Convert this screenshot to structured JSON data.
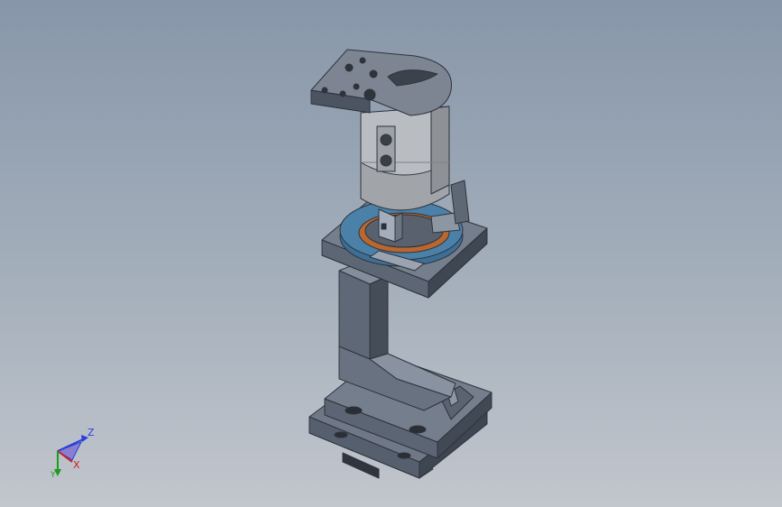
{
  "viewport": {
    "background_top": "#8796a9",
    "background_bottom": "#c2c6cd"
  },
  "model": {
    "part_color": "#66707f",
    "cylinder_color": "#b9bcc0",
    "ring_color": "#3d6f96",
    "accent_color": "#b9672f"
  },
  "triad": {
    "z_label": "Z",
    "x_label": "X",
    "y_label": "Y",
    "z_color": "#2a3fd8",
    "x_color": "#d02020",
    "y_color": "#1c9c1c"
  }
}
